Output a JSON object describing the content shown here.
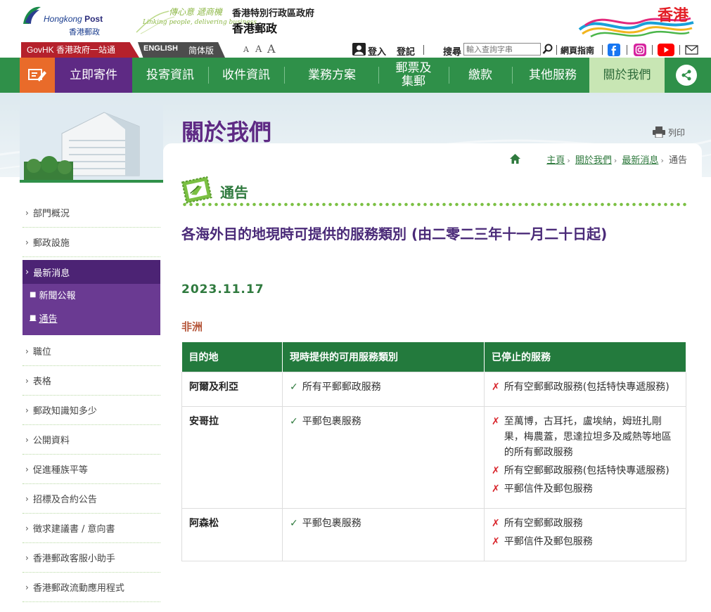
{
  "header": {
    "logo_en_prefix": "Hongkong",
    "logo_en_bold": "Post",
    "logo_zh": "香港郵政",
    "slogan_zh": "傳心意 遞商機",
    "slogan_en": "Linking people, delivering business",
    "gov_zh": "香港特別行政區政府",
    "post_zh": "香港郵政",
    "brand_hk": "香港"
  },
  "util": {
    "govhk": "GovHK 香港政府一站通",
    "lang_en": "ENGLISH",
    "lang_sc": "简体版",
    "font_sizes": [
      "A",
      "A",
      "A"
    ],
    "login": "登入",
    "register": "登記",
    "search_label": "搜尋",
    "search_placeholder": "輸入查詢字串",
    "site_guide": "網頁指南"
  },
  "nav": {
    "send": "立即寄件",
    "items": [
      "投寄資訊",
      "收件資訊",
      "業務方案",
      "郵票及\n集郵",
      "繳款",
      "其他服務"
    ],
    "about": "關於我們"
  },
  "page": {
    "title": "關於我們",
    "print": "列印",
    "breadcrumb": [
      "主頁",
      "關於我們",
      "最新消息",
      "通告"
    ]
  },
  "sidebar": {
    "items": [
      "部門概況",
      "郵政設施",
      "最新消息",
      "職位",
      "表格",
      "郵政知識知多少",
      "公開資料",
      "促進種族平等",
      "招標及合約公告",
      "徵求建議書 / 意向書",
      "香港郵政客服小助手",
      "香港郵政流動應用程式"
    ],
    "subitems": [
      "新聞公報",
      "通告"
    ]
  },
  "content": {
    "section": "通告",
    "article_title": "各海外目的地現時可提供的服務類別 (由二零二三年十一月二十日起)",
    "date": "2023.11.17",
    "region": "非洲",
    "table": {
      "headers": [
        "目的地",
        "現時提供的可用服務類別",
        "已停止的服務"
      ],
      "rows": [
        {
          "dest": "阿爾及利亞",
          "available": [
            "所有平郵郵政服務"
          ],
          "suspended": [
            "所有空郵郵政服務(包括特快專遞服務)"
          ]
        },
        {
          "dest": "安哥拉",
          "available": [
            "平郵包裹服務"
          ],
          "suspended": [
            "至萬博，古耳托，盧埃納，姆班扎剛果，梅農蓋，思達拉坦多及威熱等地區的所有郵政服務",
            "所有空郵郵政服務(包括特快專遞服務)",
            "平郵信件及郵包服務"
          ]
        },
        {
          "dest": "阿森松",
          "available": [
            "平郵包裹服務"
          ],
          "suspended": [
            "所有空郵郵政服務",
            "平郵信件及郵包服務"
          ]
        }
      ]
    }
  },
  "colors": {
    "nav_green": "#2f9049",
    "purple": "#5e2a84",
    "orange": "#e96b2a",
    "red": "#b5212c"
  }
}
